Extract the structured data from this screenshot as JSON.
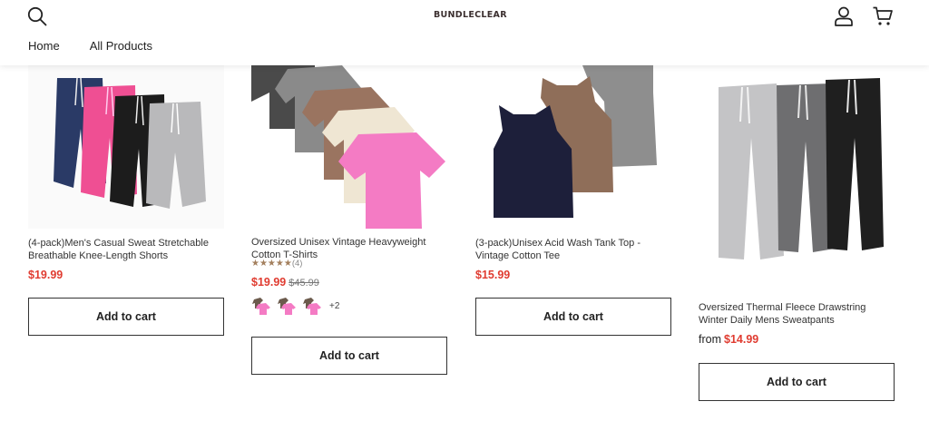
{
  "header": {
    "logo": "BUNDLECLEAR",
    "nav": [
      "Home",
      "All Products"
    ]
  },
  "products": [
    {
      "title": "(4-pack)Men's Casual Sweat Stretchable Breathable Knee-Length Shorts",
      "price": "$19.99",
      "button": "Add to cart"
    },
    {
      "title": "Oversized Unisex Vintage Heavyweight Cotton T-Shirts",
      "rating_stars": "★★★★★",
      "rating_value": 5,
      "rating_count": "(4)",
      "price": "$19.99",
      "compare_price": "$45.99",
      "swatch_more": "+2",
      "button": "Add to cart"
    },
    {
      "title": "(3-pack)Unisex Acid Wash Tank Top - Vintage Cotton Tee",
      "price": "$15.99",
      "button": "Add to cart"
    },
    {
      "title": "Oversized Thermal Fleece Drawstring Winter Daily Mens Sweatpants",
      "price_prefix": "from",
      "price": "$14.99",
      "button": "Add to cart"
    }
  ],
  "colors": {
    "price_red": "#e03c31",
    "star": "#a37f5d"
  }
}
